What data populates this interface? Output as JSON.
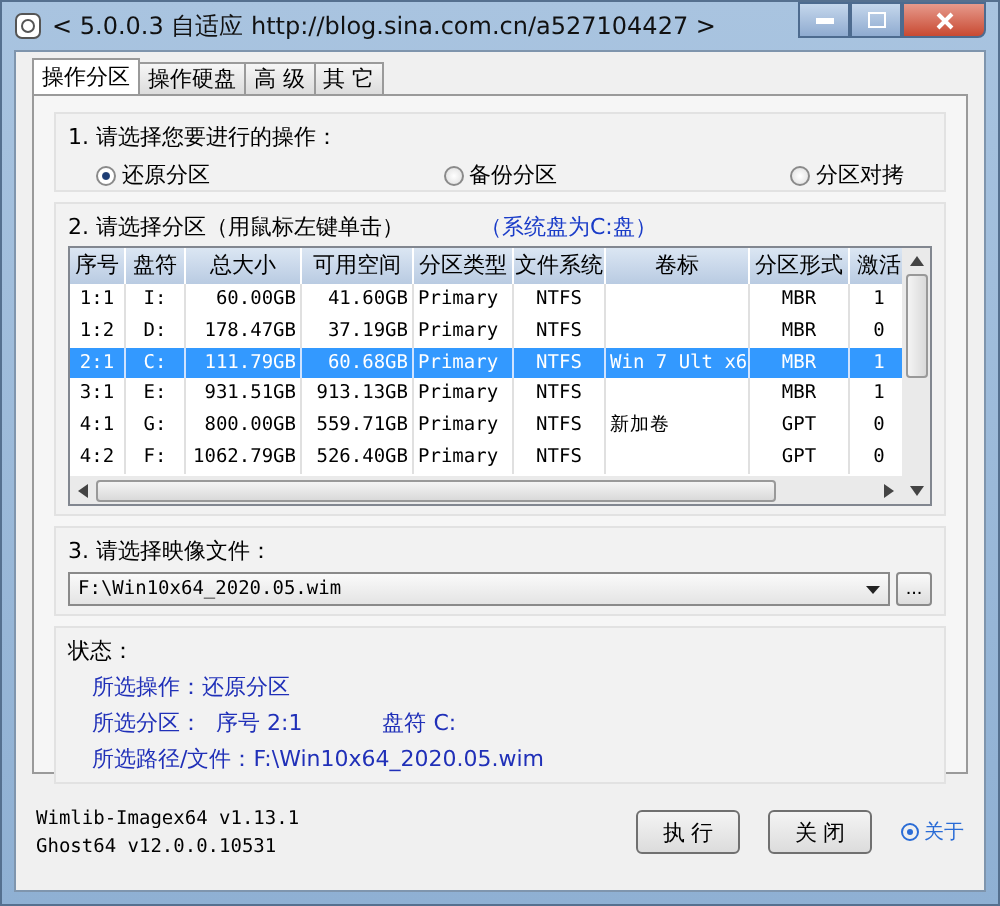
{
  "window": {
    "title": "< 5.0.0.3 自适应 http://blog.sina.com.cn/a527104427 >"
  },
  "tabs": [
    {
      "label": "操作分区",
      "selected": true
    },
    {
      "label": "操作硬盘",
      "selected": false
    },
    {
      "label": "高 级",
      "selected": false
    },
    {
      "label": "其 它",
      "selected": false
    }
  ],
  "section1": {
    "label": "1. 请选择您要进行的操作：",
    "options": [
      {
        "label": "还原分区",
        "selected": true
      },
      {
        "label": "备份分区",
        "selected": false
      },
      {
        "label": "分区对拷",
        "selected": false
      }
    ]
  },
  "section2": {
    "label": "2. 请选择分区（用鼠标左键单击）",
    "note": "（系统盘为C:盘）",
    "table": {
      "columns": [
        "序号",
        "盘符",
        "总大小",
        "可用空间",
        "分区类型",
        "文件系统",
        "卷标",
        "分区形式",
        "激活"
      ],
      "rows": [
        {
          "cells": [
            "1:1",
            "I:",
            "60.00GB",
            "41.60GB",
            "Primary",
            "NTFS",
            "",
            "MBR",
            "1"
          ],
          "selected": false
        },
        {
          "cells": [
            "1:2",
            "D:",
            "178.47GB",
            "37.19GB",
            "Primary",
            "NTFS",
            "",
            "MBR",
            "0"
          ],
          "selected": false
        },
        {
          "cells": [
            "2:1",
            "C:",
            "111.79GB",
            "60.68GB",
            "Primary",
            "NTFS",
            "Win 7 Ult x6",
            "MBR",
            "1"
          ],
          "selected": true
        },
        {
          "cells": [
            "3:1",
            "E:",
            "931.51GB",
            "913.13GB",
            "Primary",
            "NTFS",
            "",
            "MBR",
            "1"
          ],
          "selected": false
        },
        {
          "cells": [
            "4:1",
            "G:",
            "800.00GB",
            "559.71GB",
            "Primary",
            "NTFS",
            "新加卷",
            "GPT",
            "0"
          ],
          "selected": false
        },
        {
          "cells": [
            "4:2",
            "F:",
            "1062.79GB",
            "526.40GB",
            "Primary",
            "NTFS",
            "",
            "GPT",
            "0"
          ],
          "selected": false
        }
      ]
    }
  },
  "section3": {
    "label": "3. 请选择映像文件：",
    "image_file": {
      "value": "F:\\Win10x64_2020.05.wim"
    },
    "browse_button": "..."
  },
  "status": {
    "label": "状态：",
    "lines": [
      [
        "所选操作：还原分区"
      ],
      [
        "所选分区：  序号 2:1",
        "盘符 C:"
      ],
      [
        "所选路径/文件：F:\\Win10x64_2020.05.wim"
      ]
    ]
  },
  "footer": {
    "versions": [
      "Wimlib-Imagex64 v1.13.1",
      "Ghost64 v12.0.0.10531"
    ],
    "buttons": [
      "执 行",
      "关 闭"
    ],
    "about_link": "关于"
  }
}
